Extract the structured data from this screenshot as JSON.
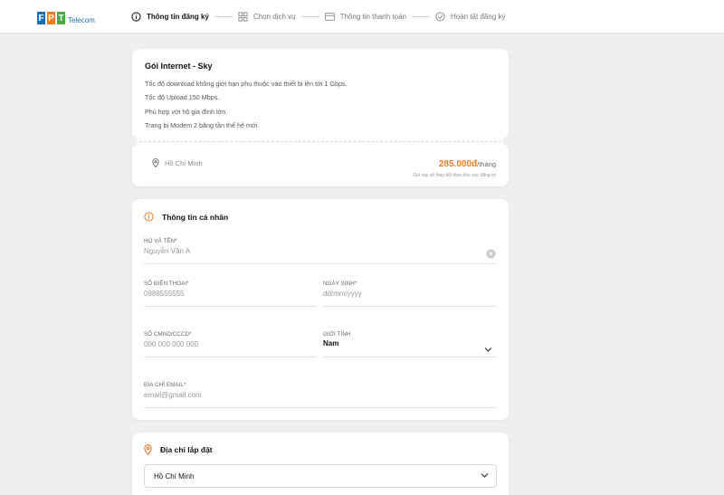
{
  "header": {
    "logo_letters": [
      "F",
      "P",
      "T"
    ],
    "logo_text": "Telecom",
    "steps": [
      {
        "label": "Thông tin đăng ký",
        "icon": "info-circle-icon",
        "active": true
      },
      {
        "label": "Chọn dịch vụ",
        "icon": "grid-icon",
        "active": false
      },
      {
        "label": "Thông tin thanh toán",
        "icon": "card-icon",
        "active": false
      },
      {
        "label": "Hoàn tất đăng ký",
        "icon": "check-circle-icon",
        "active": false
      }
    ]
  },
  "package": {
    "title": "Gói Internet - Sky",
    "features": [
      "Tốc độ download không giới hạn phụ thuộc vào thiết bị lên tới 1 Gbps.",
      "Tốc độ Upload 150 Mbps.",
      "Phù hợp với hộ gia đình lớn.",
      "Trang bị Modem 2 băng tần thế hệ mới."
    ],
    "location": "Hồ Chí Minh",
    "price": "285.000đ",
    "price_unit": "/tháng",
    "price_note": "Giá này sẽ thay đổi theo khu vực đăng ký"
  },
  "personal": {
    "title": "Thông tin cá nhân",
    "fullname": {
      "label": "HỌ VÀ TÊN",
      "placeholder": "Nguyễn Văn A",
      "required": "*"
    },
    "phone": {
      "label": "SỐ ĐIỆN THOẠI",
      "placeholder": "0988555555",
      "required": "*"
    },
    "birthday": {
      "label": "NGÀY SINH",
      "placeholder": "dd/mm/yyyy",
      "required": "*"
    },
    "idcard": {
      "label": "SỐ CMND/CCCD",
      "placeholder": "000 000 000 000",
      "required": "*"
    },
    "gender": {
      "label": "GIỚI TÍNH",
      "value": "Nam"
    },
    "email": {
      "label": "ĐỊA CHỈ EMAIL",
      "placeholder": "email@gmail.com",
      "required": "*"
    }
  },
  "address": {
    "title": "Địa chỉ lắp đặt",
    "city": "Hồ Chí Minh"
  },
  "colors": {
    "accent": "#f07c22",
    "brand_blue": "#1c6fb6",
    "brand_green": "#4aa84a",
    "required": "#e0242c"
  }
}
